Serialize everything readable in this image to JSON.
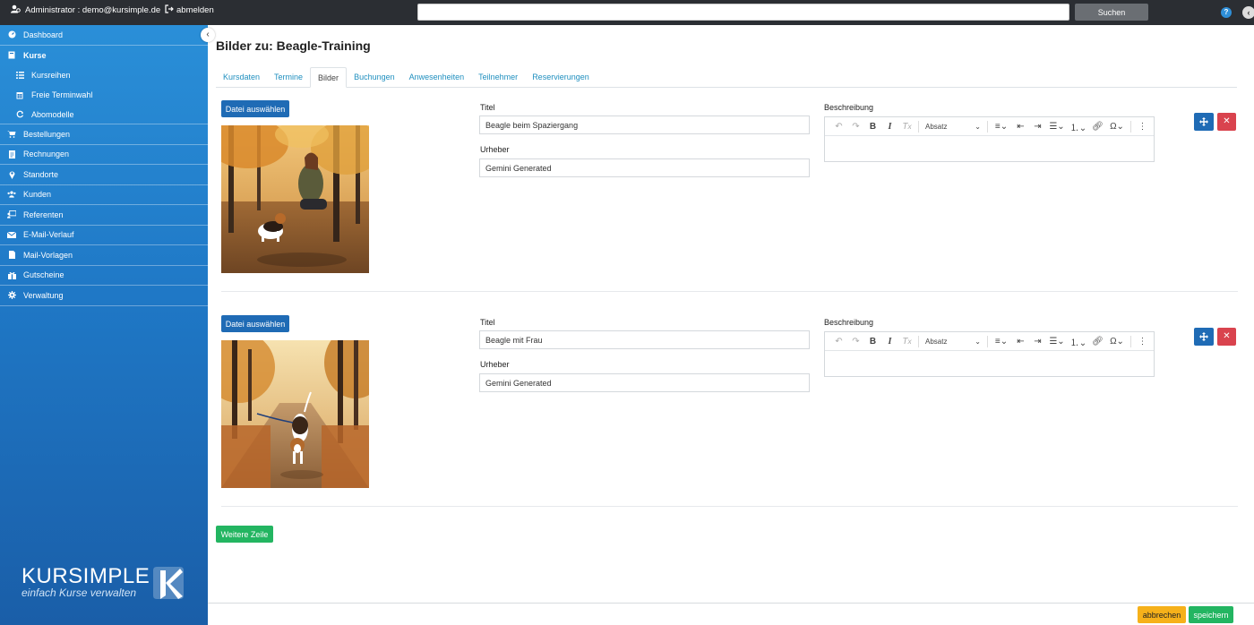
{
  "topbar": {
    "user_label": "Administrator : demo@kursimple.de",
    "logout_label": "abmelden",
    "search_value": "",
    "search_button": "Suchen",
    "help_icon": "question-circle-icon",
    "collapse_icon": "chevron-left-icon"
  },
  "sidebar": {
    "items": [
      {
        "label": "Dashboard",
        "icon": "dashboard-icon"
      },
      {
        "label": "Kurse",
        "icon": "book-icon"
      },
      {
        "label": "Kursreihen",
        "icon": "list-icon"
      },
      {
        "label": "Freie Terminwahl",
        "icon": "calendar-icon"
      },
      {
        "label": "Abomodelle",
        "icon": "refresh-icon"
      },
      {
        "label": "Bestellungen",
        "icon": "cart-icon"
      },
      {
        "label": "Rechnungen",
        "icon": "invoice-icon"
      },
      {
        "label": "Standorte",
        "icon": "map-marker-icon"
      },
      {
        "label": "Kunden",
        "icon": "users-icon"
      },
      {
        "label": "Referenten",
        "icon": "teacher-icon"
      },
      {
        "label": "E-Mail-Verlauf",
        "icon": "envelope-icon"
      },
      {
        "label": "Mail-Vorlagen",
        "icon": "template-icon"
      },
      {
        "label": "Gutscheine",
        "icon": "gift-icon"
      },
      {
        "label": "Verwaltung",
        "icon": "gear-icon"
      }
    ],
    "logo_brand": "KURSIMPLE",
    "logo_slogan": "einfach Kurse verwalten"
  },
  "page": {
    "title": "Bilder zu: Beagle-Training",
    "tabs": [
      "Kursdaten",
      "Termine",
      "Bilder",
      "Buchungen",
      "Anwesenheiten",
      "Teilnehmer",
      "Reservierungen"
    ],
    "active_tab": "Bilder"
  },
  "rows": [
    {
      "file_button": "Datei auswählen",
      "titel_label": "Titel",
      "titel_value": "Beagle beim Spaziergang",
      "urheber_label": "Urheber",
      "urheber_value": "Gemini Generated",
      "beschreibung_label": "Beschreibung",
      "format_select": "Absatz"
    },
    {
      "file_button": "Datei auswählen",
      "titel_label": "Titel",
      "titel_value": "Beagle mit Frau",
      "urheber_label": "Urheber",
      "urheber_value": "Gemini Generated",
      "beschreibung_label": "Beschreibung",
      "format_select": "Absatz"
    }
  ],
  "actions": {
    "add_row": "Weitere Zeile",
    "cancel": "abbrechen",
    "save": "speichern"
  },
  "colors": {
    "sidebar": "#1f78c6",
    "primary": "#1f6bb5",
    "success": "#23b561",
    "danger": "#d9434e",
    "warning": "#f6b11a",
    "tab_link": "#1f8fbf"
  }
}
